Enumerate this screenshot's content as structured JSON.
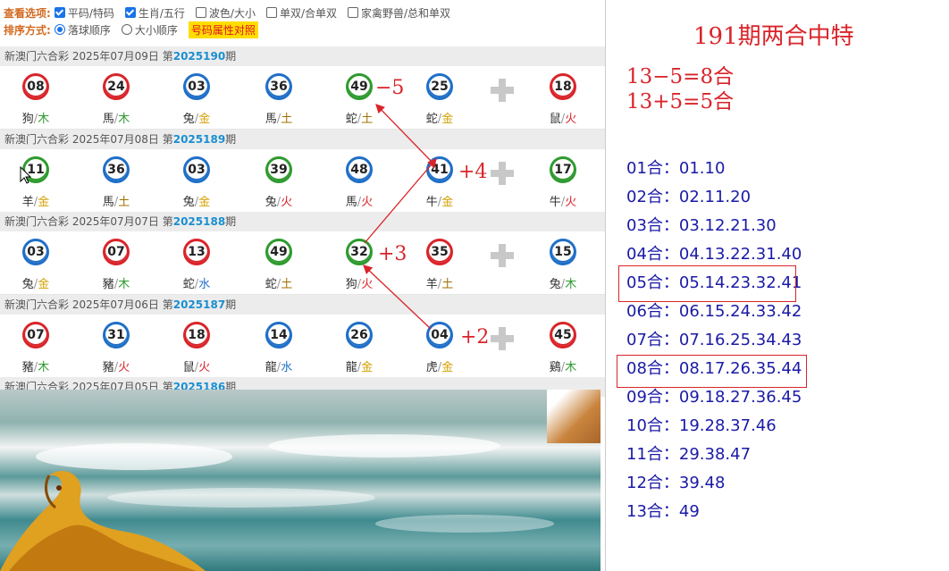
{
  "options": {
    "view_label": "查看选项:",
    "view_options": [
      {
        "label": "平码/特码",
        "checked": true
      },
      {
        "label": "生肖/五行",
        "checked": true
      },
      {
        "label": "波色/大小",
        "checked": false
      },
      {
        "label": "单双/合单双",
        "checked": false
      },
      {
        "label": "家禽野兽/总和单双",
        "checked": false
      }
    ],
    "sort_label": "排序方式:",
    "sort_options": [
      {
        "label": "落球顺序",
        "selected": true
      },
      {
        "label": "大小顺序",
        "selected": false
      }
    ],
    "attr_button": "号码属性对照"
  },
  "draws": [
    {
      "prefix": "新澳门六合彩 2025年07月09日 第",
      "issue": "2025190",
      "suffix": "期",
      "balls": [
        {
          "num": "08",
          "color": "red",
          "zodiac": "狗",
          "element": "木"
        },
        {
          "num": "24",
          "color": "red",
          "zodiac": "馬",
          "element": "木"
        },
        {
          "num": "03",
          "color": "blue",
          "zodiac": "兔",
          "element": "金"
        },
        {
          "num": "36",
          "color": "blue",
          "zodiac": "馬",
          "element": "土"
        },
        {
          "num": "49",
          "color": "green",
          "zodiac": "蛇",
          "element": "土"
        },
        {
          "num": "25",
          "color": "blue",
          "zodiac": "蛇",
          "element": "金"
        },
        {
          "num": "18",
          "color": "red",
          "zodiac": "鼠",
          "element": "火"
        }
      ]
    },
    {
      "prefix": "新澳门六合彩 2025年07月08日 第",
      "issue": "2025189",
      "suffix": "期",
      "balls": [
        {
          "num": "11",
          "color": "green",
          "zodiac": "羊",
          "element": "金"
        },
        {
          "num": "36",
          "color": "blue",
          "zodiac": "馬",
          "element": "土"
        },
        {
          "num": "03",
          "color": "blue",
          "zodiac": "兔",
          "element": "金"
        },
        {
          "num": "39",
          "color": "green",
          "zodiac": "兔",
          "element": "火"
        },
        {
          "num": "48",
          "color": "blue",
          "zodiac": "馬",
          "element": "火"
        },
        {
          "num": "41",
          "color": "blue",
          "zodiac": "牛",
          "element": "金"
        },
        {
          "num": "17",
          "color": "green",
          "zodiac": "牛",
          "element": "火"
        }
      ]
    },
    {
      "prefix": "新澳门六合彩 2025年07月07日 第",
      "issue": "2025188",
      "suffix": "期",
      "balls": [
        {
          "num": "03",
          "color": "blue",
          "zodiac": "兔",
          "element": "金"
        },
        {
          "num": "07",
          "color": "red",
          "zodiac": "豬",
          "element": "木"
        },
        {
          "num": "13",
          "color": "red",
          "zodiac": "蛇",
          "element": "水"
        },
        {
          "num": "49",
          "color": "green",
          "zodiac": "蛇",
          "element": "土"
        },
        {
          "num": "32",
          "color": "green",
          "zodiac": "狗",
          "element": "火"
        },
        {
          "num": "35",
          "color": "red",
          "zodiac": "羊",
          "element": "土"
        },
        {
          "num": "15",
          "color": "blue",
          "zodiac": "兔",
          "element": "木"
        }
      ]
    },
    {
      "prefix": "新澳门六合彩 2025年07月06日 第",
      "issue": "2025187",
      "suffix": "期",
      "balls": [
        {
          "num": "07",
          "color": "red",
          "zodiac": "豬",
          "element": "木"
        },
        {
          "num": "31",
          "color": "blue",
          "zodiac": "豬",
          "element": "火"
        },
        {
          "num": "18",
          "color": "red",
          "zodiac": "鼠",
          "element": "火"
        },
        {
          "num": "14",
          "color": "blue",
          "zodiac": "龍",
          "element": "水"
        },
        {
          "num": "26",
          "color": "blue",
          "zodiac": "龍",
          "element": "金"
        },
        {
          "num": "04",
          "color": "blue",
          "zodiac": "虎",
          "element": "金"
        },
        {
          "num": "45",
          "color": "red",
          "zodiac": "鷄",
          "element": "木"
        }
      ]
    },
    {
      "prefix": "新澳门六合彩 2025年07月05日 第",
      "issue": "2025186",
      "suffix": "期",
      "balls": []
    }
  ],
  "annotations": [
    "−5",
    "+4",
    "+3",
    "+2"
  ],
  "right_panel": {
    "title": "191期两合中特",
    "formulas": [
      "13−5=8合",
      "13+5=5合"
    ],
    "he_list": [
      {
        "label": "01合",
        "nums": "01.10"
      },
      {
        "label": "02合",
        "nums": "02.11.20"
      },
      {
        "label": "03合",
        "nums": "03.12.21.30"
      },
      {
        "label": "04合",
        "nums": "04.13.22.31.40"
      },
      {
        "label": "05合",
        "nums": "05.14.23.32.41"
      },
      {
        "label": "06合",
        "nums": "06.15.24.33.42"
      },
      {
        "label": "07合",
        "nums": "07.16.25.34.43"
      },
      {
        "label": "08合",
        "nums": "08.17.26.35.44"
      },
      {
        "label": "09合",
        "nums": "09.18.27.36.45"
      },
      {
        "label": "10合",
        "nums": "19.28.37.46"
      },
      {
        "label": "11合",
        "nums": "29.38.47"
      },
      {
        "label": "12合",
        "nums": "39.48"
      },
      {
        "label": "13合",
        "nums": "49"
      }
    ],
    "colon": "："
  },
  "colors": {
    "red": "#d9242a",
    "blue": "#1f6fc7",
    "green": "#2e9a2e",
    "accent_blue": "#1a1aa6"
  }
}
